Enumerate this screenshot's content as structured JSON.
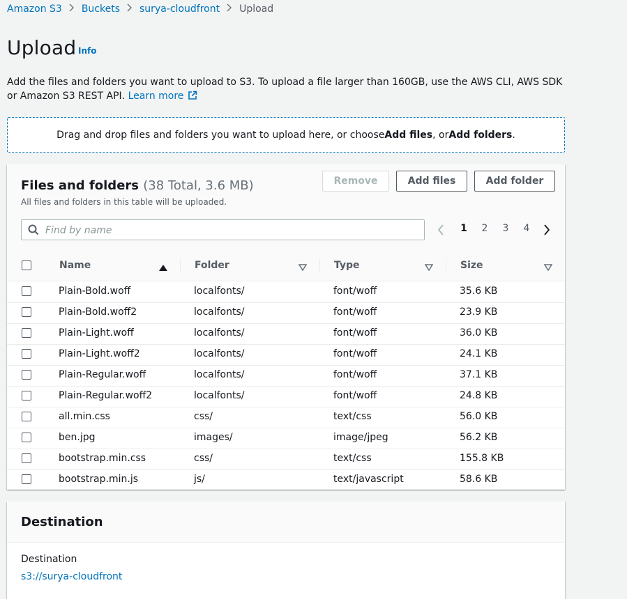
{
  "breadcrumb": {
    "items": [
      "Amazon S3",
      "Buckets",
      "surya-cloudfront"
    ],
    "current": "Upload"
  },
  "page": {
    "title": "Upload",
    "info": "Info",
    "description": "Add the files and folders you want to upload to S3. To upload a file larger than 160GB, use the AWS CLI, AWS SDK or Amazon S3 REST API.",
    "learn_more": "Learn more"
  },
  "dropzone": {
    "text_before": "Drag and drop files and folders you want to upload here, or choose ",
    "add_files": "Add files",
    "text_mid": ", or ",
    "add_folders": "Add folders",
    "text_after": "."
  },
  "files_panel": {
    "title": "Files and folders",
    "count": "(38 Total, 3.6 MB)",
    "subtitle": "All files and folders in this table will be uploaded.",
    "buttons": {
      "remove": "Remove",
      "add_files": "Add files",
      "add_folder": "Add folder"
    },
    "search_placeholder": "Find by name",
    "pages": [
      "1",
      "2",
      "3",
      "4"
    ],
    "current_page": "1",
    "columns": {
      "name": "Name",
      "folder": "Folder",
      "type": "Type",
      "size": "Size"
    },
    "rows": [
      {
        "name": "Plain-Bold.woff",
        "folder": "localfonts/",
        "type": "font/woff",
        "size": "35.6 KB"
      },
      {
        "name": "Plain-Bold.woff2",
        "folder": "localfonts/",
        "type": "font/woff",
        "size": "23.9 KB"
      },
      {
        "name": "Plain-Light.woff",
        "folder": "localfonts/",
        "type": "font/woff",
        "size": "36.0 KB"
      },
      {
        "name": "Plain-Light.woff2",
        "folder": "localfonts/",
        "type": "font/woff",
        "size": "24.1 KB"
      },
      {
        "name": "Plain-Regular.woff",
        "folder": "localfonts/",
        "type": "font/woff",
        "size": "37.1 KB"
      },
      {
        "name": "Plain-Regular.woff2",
        "folder": "localfonts/",
        "type": "font/woff",
        "size": "24.8 KB"
      },
      {
        "name": "all.min.css",
        "folder": "css/",
        "type": "text/css",
        "size": "56.0 KB"
      },
      {
        "name": "ben.jpg",
        "folder": "images/",
        "type": "image/jpeg",
        "size": "56.2 KB"
      },
      {
        "name": "bootstrap.min.css",
        "folder": "css/",
        "type": "text/css",
        "size": "155.8 KB"
      },
      {
        "name": "bootstrap.min.js",
        "folder": "js/",
        "type": "text/javascript",
        "size": "58.6 KB"
      }
    ]
  },
  "destination": {
    "title": "Destination",
    "label": "Destination",
    "path": "s3://surya-cloudfront"
  },
  "colors": {
    "link": "#0073bb",
    "text": "#16191f",
    "muted": "#545b64",
    "background": "#f2f3f3"
  }
}
